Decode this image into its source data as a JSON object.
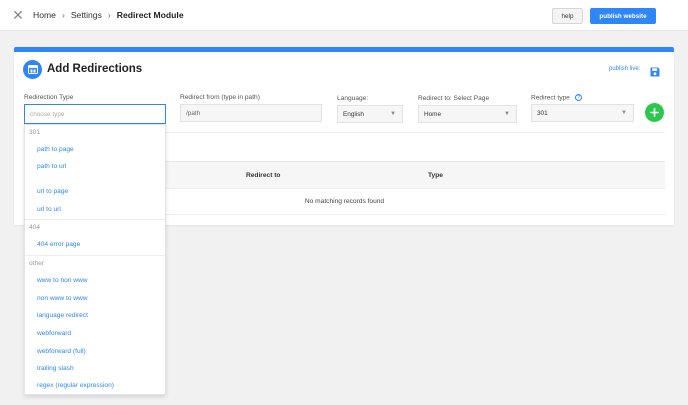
{
  "topbar": {
    "breadcrumb": [
      "Home",
      "Settings",
      "Redirect Module"
    ],
    "help_label": "help",
    "publish_label": "publish website"
  },
  "card": {
    "title": "Add Redirections",
    "publish_live_label": "publish live:"
  },
  "form": {
    "redirection_type": {
      "label": "Redirection Type",
      "placeholder": "choose type"
    },
    "redirect_from": {
      "label": "Redirect from (type in path)",
      "value": "/path"
    },
    "language": {
      "label": "Language:",
      "value": "English"
    },
    "redirect_to": {
      "label": "Redirect to: Select Page",
      "value": "Home"
    },
    "redirect_type": {
      "label": "Redirect type",
      "value": "301"
    }
  },
  "table": {
    "columns": [
      "Redirect to",
      "Type"
    ],
    "empty_message": "No matching records found"
  },
  "dropdown": {
    "groups": [
      {
        "name": "301",
        "items": [
          "path to page",
          "path to url",
          "url to page",
          "url to url"
        ]
      },
      {
        "name": "404",
        "items": [
          "404 error page"
        ]
      },
      {
        "name": "other",
        "items": [
          "www to non www",
          "non www to www",
          "language redirect",
          "webforward",
          "webforward (full)",
          "trailing slash",
          "regex (regular expression)"
        ]
      }
    ]
  },
  "colors": {
    "accent": "#2f86f6",
    "add_button": "#2cc84d",
    "background": "#f1f1f2"
  },
  "icons": [
    "close-icon",
    "module-icon",
    "save-icon",
    "help-icon",
    "plus-icon",
    "caret-down-icon"
  ]
}
